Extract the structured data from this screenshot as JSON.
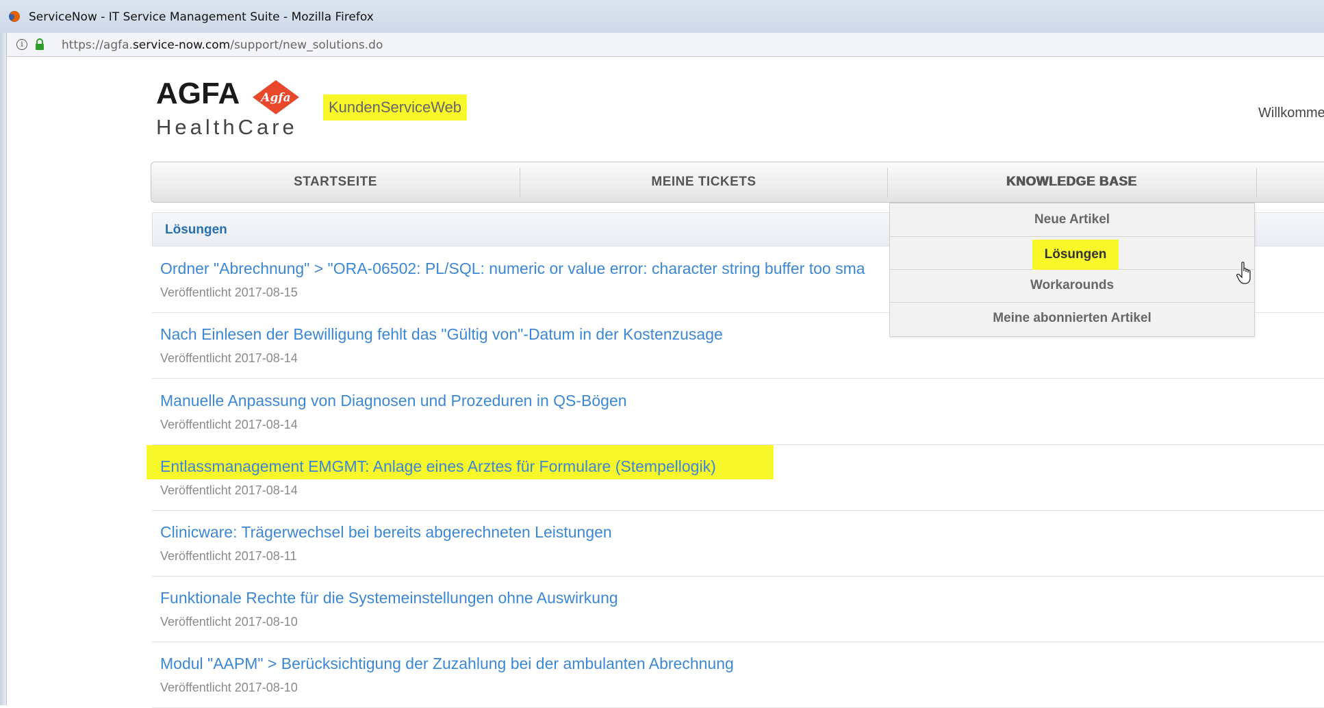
{
  "window": {
    "title": "ServiceNow - IT Service Management Suite - Mozilla Firefox",
    "url_prefix": "https://agfa.",
    "url_domain": "service-now.com",
    "url_path": "/support/new_solutions.do"
  },
  "header": {
    "logo_word": "AGFA",
    "logo_badge": "Agfa",
    "logo_sub": "HealthCare",
    "site_name": "KundenServiceWeb",
    "welcome": "Willkomme"
  },
  "nav": {
    "items": [
      {
        "label": "STARTSEITE"
      },
      {
        "label": "MEINE TICKETS"
      },
      {
        "label": "KNOWLEDGE BASE"
      }
    ]
  },
  "dropdown": {
    "items": [
      {
        "label": "Neue Artikel"
      },
      {
        "label": "Lösungen"
      },
      {
        "label": "Workarounds"
      },
      {
        "label": "Meine abonnierten Artikel"
      }
    ]
  },
  "solutions": {
    "header": "Lösungen",
    "items": [
      {
        "title": "Ordner \"Abrechnung\" > \"ORA-06502: PL/SQL: numeric or value error: character string buffer too sma",
        "date": "Veröffentlicht 2017-08-15"
      },
      {
        "title": "Nach Einlesen der Bewilligung fehlt das \"Gültig von\"-Datum in der Kostenzusage",
        "date": "Veröffentlicht 2017-08-14"
      },
      {
        "title": "Manuelle Anpassung von Diagnosen und Prozeduren in QS-Bögen",
        "date": "Veröffentlicht 2017-08-14"
      },
      {
        "title": "Entlassmanagement EMGMT: Anlage eines Arztes für Formulare (Stempellogik)",
        "date": "Veröffentlicht 2017-08-14"
      },
      {
        "title": "Clinicware: Trägerwechsel bei bereits abgerechneten Leistungen",
        "date": "Veröffentlicht 2017-08-11"
      },
      {
        "title": "Funktionale Rechte für die Systemeinstellungen ohne Auswirkung",
        "date": "Veröffentlicht 2017-08-10"
      },
      {
        "title": "Modul \"AAPM\" > Berücksichtigung der Zuzahlung bei der ambulanten Abrechnung",
        "date": "Veröffentlicht 2017-08-10"
      }
    ]
  },
  "colors": {
    "link": "#3c87d3",
    "highlight": "#f7f72a",
    "logo_accent": "#e8482c"
  }
}
